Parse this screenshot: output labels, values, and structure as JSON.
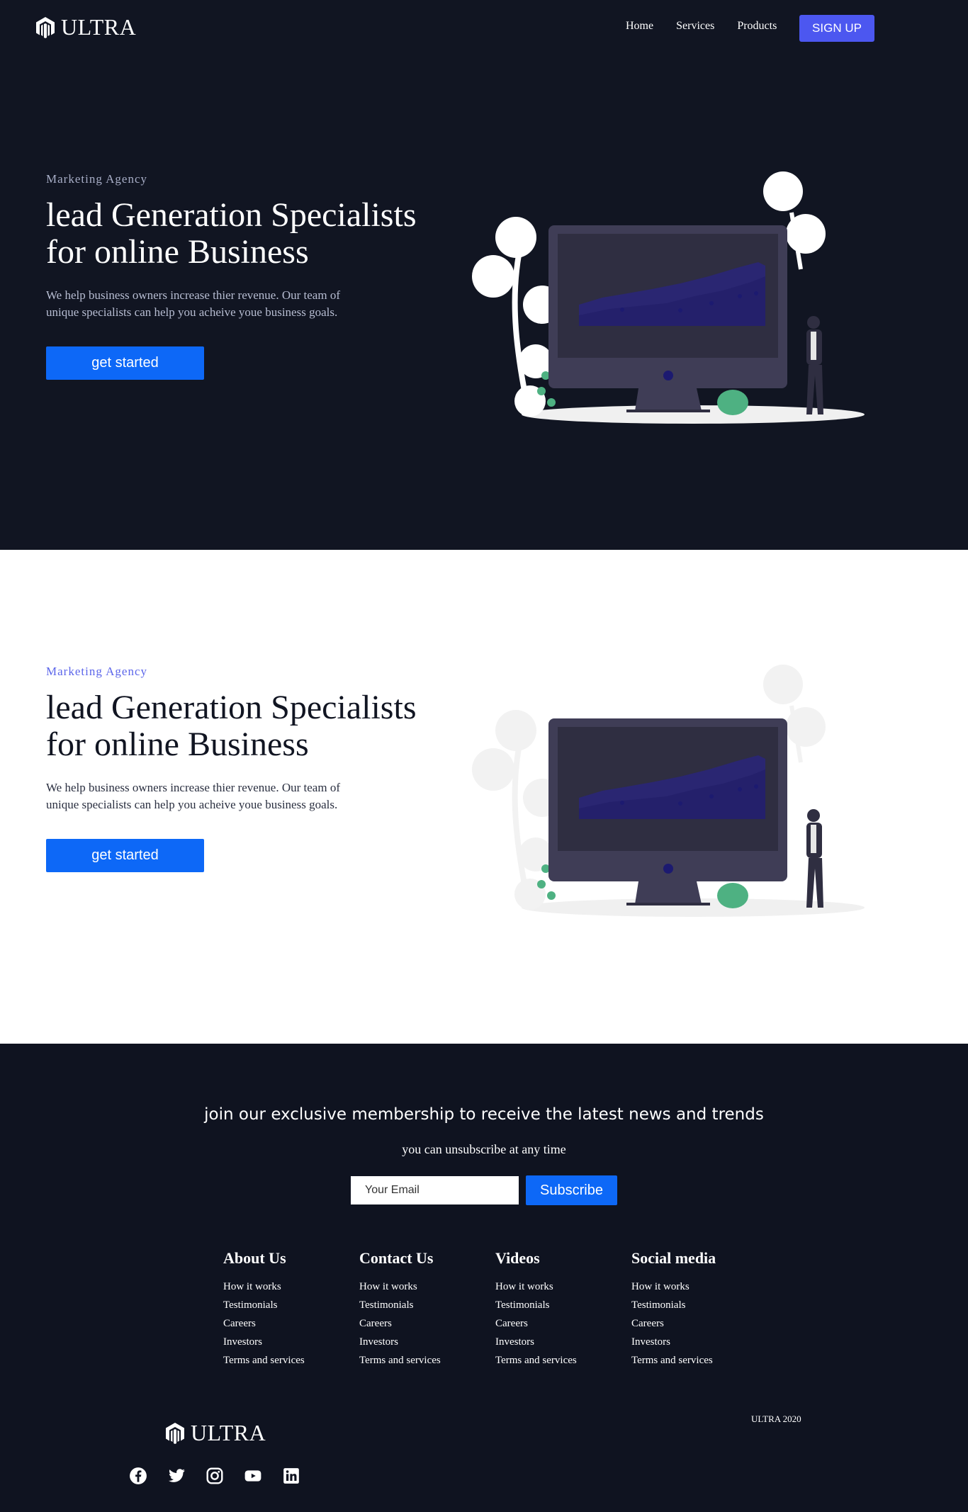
{
  "nav": {
    "brand": "ULTRA",
    "links": [
      "Home",
      "Services",
      "Products"
    ],
    "signup": "SIGN UP"
  },
  "hero_dark": {
    "eyebrow": "Marketing Agency",
    "title_line1": "lead Generation Specialists",
    "title_line2": "for online Business",
    "text_line1": "We help business owners increase thier revenue. Our team of",
    "text_line2": "unique specialists can help you acheive youe business goals.",
    "cta": "get started"
  },
  "hero_light": {
    "eyebrow": "Marketing Agency",
    "title_line1": "lead Generation Specialists",
    "title_line2": "for online Business",
    "text_line1": "We help business owners increase thier revenue. Our team of",
    "text_line2": "unique specialists can help you acheive youe business goals.",
    "cta": "get started"
  },
  "newsletter": {
    "title": "join our exclusive membership to receive the latest news and trends",
    "subtitle": "you can unsubscribe at any time",
    "email_placeholder": "Your Email",
    "button": "Subscribe"
  },
  "footer": {
    "columns": [
      {
        "title": "About Us",
        "links": [
          "How it works",
          "Testimonials",
          "Careers",
          "Investors",
          "Terms and services"
        ]
      },
      {
        "title": "Contact Us",
        "links": [
          "How it works",
          "Testimonials",
          "Careers",
          "Investors",
          "Terms and services"
        ]
      },
      {
        "title": "Videos",
        "links": [
          "How it works",
          "Testimonials",
          "Careers",
          "Investors",
          "Terms and services"
        ]
      },
      {
        "title": "Social media",
        "links": [
          "How it works",
          "Testimonials",
          "Careers",
          "Investors",
          "Terms and services"
        ]
      }
    ],
    "brand": "ULTRA",
    "copyright": "ULTRA 2020",
    "social_icons": [
      "facebook-icon",
      "twitter-icon",
      "instagram-icon",
      "youtube-icon",
      "linkedin-icon"
    ]
  },
  "colors": {
    "dark_bg": "#111522",
    "accent_blue": "#0d68f7",
    "signup_purple": "#4c57f0",
    "eyebrow_purple": "#5b65ea"
  }
}
